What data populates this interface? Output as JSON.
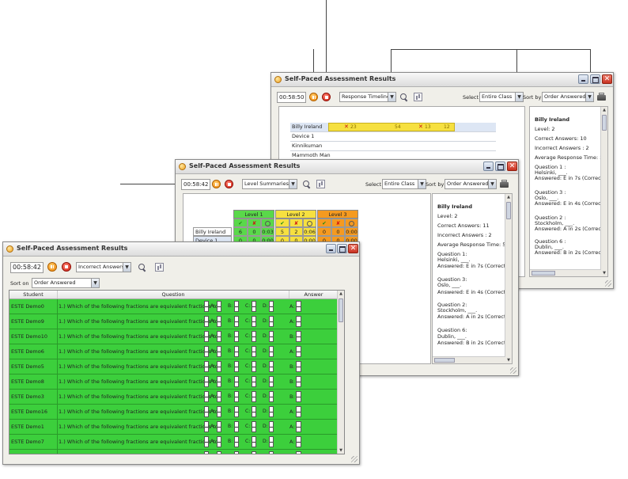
{
  "window_title": "Self-Paced Assessment Results",
  "back_window": {
    "timer": "00:58:50",
    "view_dropdown": "Response Timeline",
    "select_label": "Select",
    "select_value": "Entire Class",
    "sortby_label": "Sort by",
    "sortby_value": "Order Answered",
    "timeline_rows": [
      {
        "name": "Billy Ireland",
        "marks": [
          "23",
          "54",
          "13",
          "12"
        ]
      },
      {
        "name": "Device 1"
      },
      {
        "name": "Kinnikuman"
      },
      {
        "name": "Mammoth Man"
      }
    ],
    "detail": {
      "name": "Billy Ireland",
      "level": "Level: 2",
      "correct": "Correct Answers: 10",
      "incorrect": "Incorrect Answers : 2",
      "avg": "Average Response Time: 5s",
      "questions": [
        {
          "q": "Question 1 :",
          "text": "Helsinki, ___.",
          "ans": "Answered: E in 7s (Correct)"
        },
        {
          "q": "Question 3 :",
          "text": "Oslo, ___.",
          "ans": "Answered: E in 4s (Correct)"
        },
        {
          "q": "Question 2 :",
          "text": "Stockholm, ___.",
          "ans": "Answered: A in 2s (Correct)"
        },
        {
          "q": "Question 6 :",
          "text": "Dublin, ___.",
          "ans": "Answered: B in 2s (Correct)"
        }
      ]
    }
  },
  "mid_window": {
    "timer": "00:58:42",
    "view_dropdown": "Level Summaries",
    "select_label": "Select",
    "select_value": "Entire Class",
    "sortby_label": "Sort by",
    "sortby_value": "Order Answered",
    "levels": [
      "Level 1",
      "Level 2",
      "Level 3"
    ],
    "level_colors": [
      "#5ad84a",
      "#f6e040",
      "#f59a20"
    ],
    "rows": [
      {
        "name": "Billy Ireland",
        "vals": [
          "6",
          "0",
          "0:03",
          "5",
          "2",
          "0:06",
          "0",
          "0",
          "0:00"
        ]
      },
      {
        "name": "Device 1",
        "vals": [
          "0",
          "0",
          "0:00",
          "0",
          "0",
          "0:00",
          "0",
          "0",
          "0:00"
        ]
      }
    ],
    "detail": {
      "name": "Billy Ireland",
      "level": "Level: 2",
      "correct": "Correct Answers: 11",
      "incorrect": "Incorrect Answers : 2",
      "avg": "Average Response Time: 5s",
      "questions": [
        {
          "q": "Question 1:",
          "text": "Helsinki, ___.",
          "ans": "Answered: E in 7s (Correct)"
        },
        {
          "q": "Question 3:",
          "text": "Oslo, ___.",
          "ans": "Answered: E in 4s (Correct)"
        },
        {
          "q": "Question 2:",
          "text": "Stockholm, ___.",
          "ans": "Answered: A in 2s (Correct)"
        },
        {
          "q": "Question 6:",
          "text": "Dublin, ___.",
          "ans": "Answered: B in 2s (Correct)"
        }
      ]
    }
  },
  "front_window": {
    "timer": "00:58:42",
    "view_dropdown": "Incorrect Answers",
    "sort_label": "Sort on",
    "sort_value": "Order Answered",
    "columns": [
      "Student",
      "Question",
      "Answer"
    ],
    "question_text": "1.) Which of the following fractions are equivalent fractions to",
    "option_letters": [
      "A:",
      "B:",
      "C:",
      "D:"
    ],
    "rows": [
      {
        "student": "ESTE Demo0",
        "answer": "A:"
      },
      {
        "student": "ESTE Demo9",
        "answer": "A:"
      },
      {
        "student": "ESTE Demo10",
        "answer": "B:"
      },
      {
        "student": "ESTE Demo6",
        "answer": "A:"
      },
      {
        "student": "ESTE Demo5",
        "answer": "B:"
      },
      {
        "student": "ESTE Demo8",
        "answer": "B:"
      },
      {
        "student": "ESTE Demo3",
        "answer": "B:"
      },
      {
        "student": "ESTE Demo16",
        "answer": "A:"
      },
      {
        "student": "ESTE Demo1",
        "answer": "A:"
      },
      {
        "student": "ESTE Demo7",
        "answer": "A:"
      },
      {
        "student": "ESTE Demo4",
        "answer": "B:"
      }
    ],
    "row_color": "#3ccf3c"
  }
}
